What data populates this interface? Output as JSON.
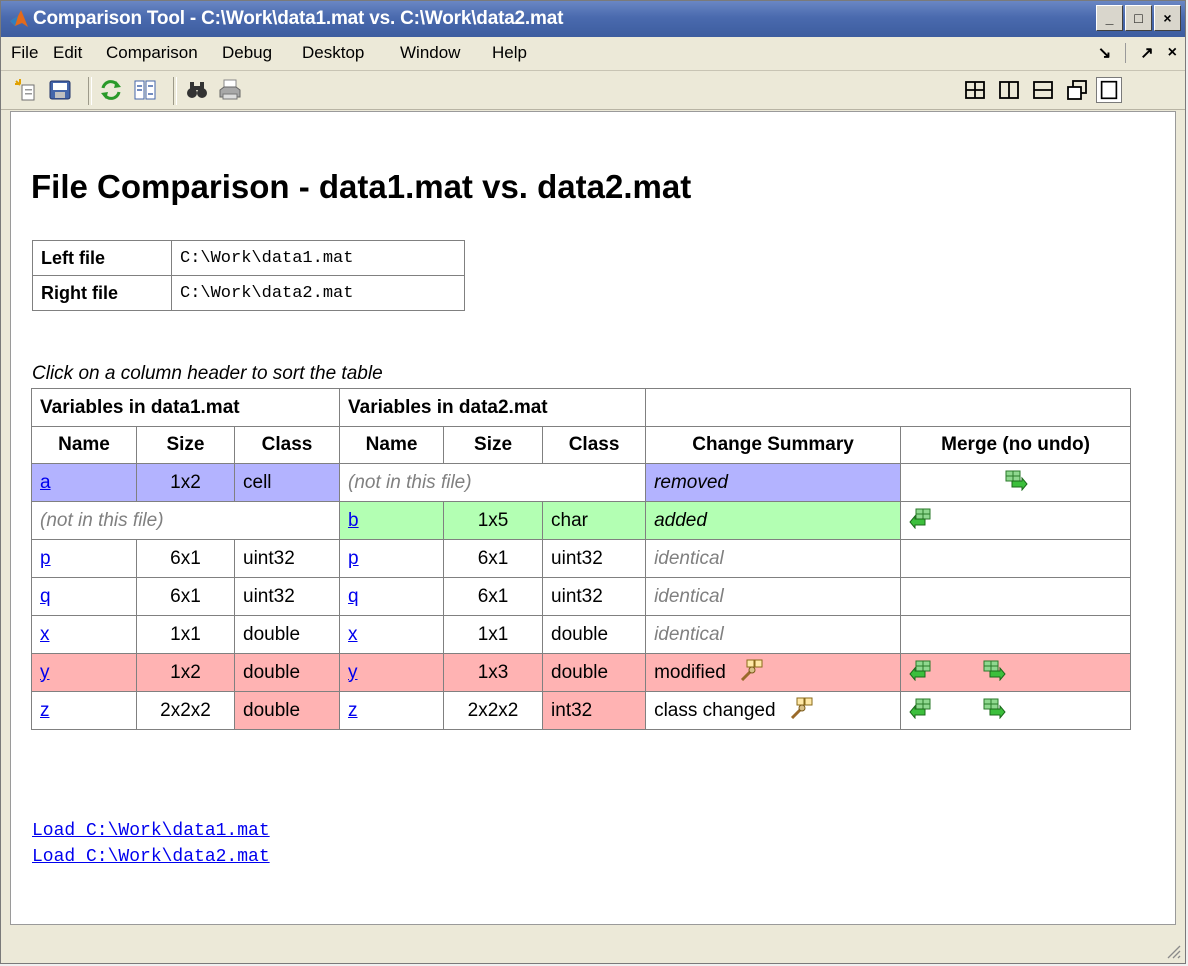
{
  "window": {
    "title": "Comparison Tool - C:\\Work\\data1.mat vs. C:\\Work\\data2.mat",
    "controls": {
      "minimize": "_",
      "maximize": "□",
      "close": "×"
    }
  },
  "menu": {
    "items": [
      "File",
      "Edit",
      "Comparison",
      "Debug",
      "Desktop",
      "Window",
      "Help"
    ],
    "right": {
      "dock": "↘",
      "undock": "↗",
      "close": "×"
    }
  },
  "page": {
    "title": "File Comparison - data1.mat vs. data2.mat",
    "files": [
      {
        "label": "Left file",
        "path": "C:\\Work\\data1.mat"
      },
      {
        "label": "Right file",
        "path": "C:\\Work\\data2.mat"
      }
    ],
    "sort_hint": "Click on a column header to sort the table",
    "table": {
      "group_left": "Variables in data1.mat",
      "group_right": "Variables in data2.mat",
      "headers": [
        "Name",
        "Size",
        "Class",
        "Name",
        "Size",
        "Class",
        "Change Summary",
        "Merge (no undo)"
      ],
      "rows": [
        {
          "l_name": "a",
          "l_size": "1x2",
          "l_class": "cell",
          "r_absent": "(not in this file)",
          "summary": "removed"
        },
        {
          "l_absent": "(not in this file)",
          "r_name": "b",
          "r_size": "1x5",
          "r_class": "char",
          "summary": "added"
        },
        {
          "l_name": "p",
          "l_size": "6x1",
          "l_class": "uint32",
          "r_name": "p",
          "r_size": "6x1",
          "r_class": "uint32",
          "summary": "identical"
        },
        {
          "l_name": "q",
          "l_size": "6x1",
          "l_class": "uint32",
          "r_name": "q",
          "r_size": "6x1",
          "r_class": "uint32",
          "summary": "identical"
        },
        {
          "l_name": "x",
          "l_size": "1x1",
          "l_class": "double",
          "r_name": "x",
          "r_size": "1x1",
          "r_class": "double",
          "summary": "identical"
        },
        {
          "l_name": "y",
          "l_size": "1x2",
          "l_class": "double",
          "r_name": "y",
          "r_size": "1x3",
          "r_class": "double",
          "summary": "modified"
        },
        {
          "l_name": "z",
          "l_size": "2x2x2",
          "l_class": "double",
          "r_name": "z",
          "r_size": "2x2x2",
          "r_class": "int32",
          "summary": "class changed"
        }
      ]
    },
    "load_links": [
      "Load C:\\Work\\data1.mat",
      "Load C:\\Work\\data2.mat"
    ]
  },
  "colors": {
    "removed": "#b3b3ff",
    "added": "#b3ffb3",
    "changed": "#ffb3b3",
    "link": "#0000ee",
    "titlebar": "#4a6aae"
  }
}
